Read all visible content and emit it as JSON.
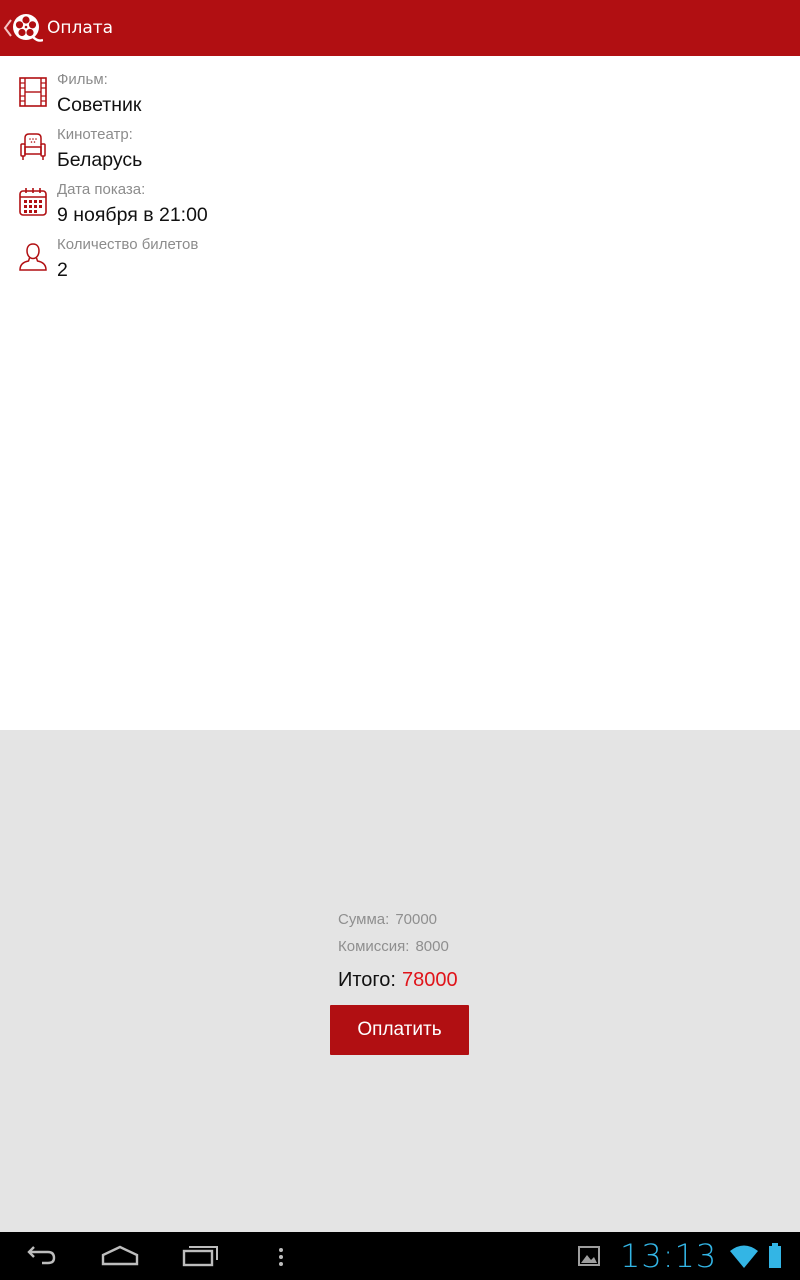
{
  "appbar": {
    "title": "Оплата",
    "background_color": "#b10f12"
  },
  "details": [
    {
      "icon": "film-strip-icon",
      "label": "Фильм:",
      "value": "Советник"
    },
    {
      "icon": "cinema-seat-icon",
      "label": "Кинотеатр:",
      "value": "Беларусь"
    },
    {
      "icon": "calendar-icon",
      "label": "Дата показа:",
      "value": "9 ноября в 21:00"
    },
    {
      "icon": "person-icon",
      "label": "Количество билетов",
      "value": "2"
    }
  ],
  "summary": {
    "sum_label": "Сумма:",
    "sum_value": "70000",
    "fee_label": "Комиссия:",
    "fee_value": "8000",
    "total_label": "Итого:",
    "total_value": "78000",
    "pay_button_label": "Оплатить",
    "accent_color": "#e0141a"
  },
  "status_bar": {
    "time": "13:13",
    "accent_color": "#33b5e5"
  }
}
